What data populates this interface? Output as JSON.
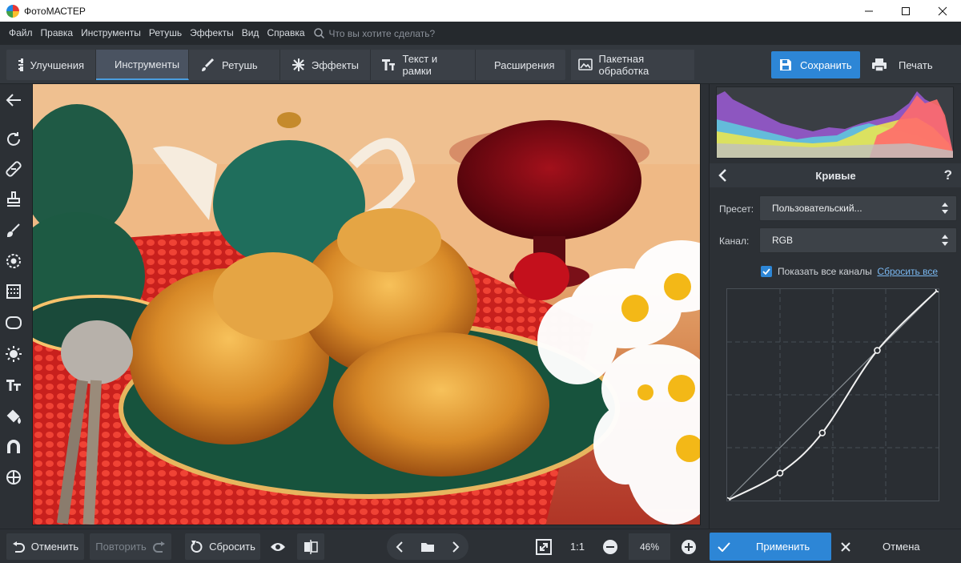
{
  "window": {
    "title": "ФотоМАСТЕР",
    "controls": [
      "minimize",
      "maximize",
      "close"
    ]
  },
  "menu": {
    "items": [
      "Файл",
      "Правка",
      "Инструменты",
      "Ретушь",
      "Эффекты",
      "Вид",
      "Справка"
    ],
    "search_placeholder": "Что вы хотите сделать?"
  },
  "toolbar": {
    "tabs": [
      {
        "label": "Улучшения",
        "icon": "sliders-icon",
        "active": false
      },
      {
        "label": "Инструменты",
        "icon": "crop-icon",
        "active": true
      },
      {
        "label": "Ретушь",
        "icon": "brush-icon",
        "active": false
      },
      {
        "label": "Эффекты",
        "icon": "sparkle-icon",
        "active": false
      },
      {
        "label": "Текст и рамки",
        "icon": "text-icon",
        "active": false
      },
      {
        "label": "Расширения",
        "icon": "plus-icon",
        "active": false
      }
    ],
    "batch_label": "Пакетная обработка",
    "save_label": "Сохранить",
    "print_label": "Печать"
  },
  "left_tools": [
    "back-arrow-icon",
    "rotate-icon",
    "healing-icon",
    "stamp-icon",
    "brush-icon",
    "radial-icon",
    "gradient-icon",
    "vignette-icon",
    "light-icon",
    "text-icon",
    "fill-icon",
    "magnet-icon",
    "target-icon"
  ],
  "panel": {
    "title": "Кривые",
    "help": "?",
    "preset_label": "Пресет:",
    "preset_value": "Пользовательский...",
    "channel_label": "Канал:",
    "channel_value": "RGB",
    "show_all_channels": "Показать все каналы",
    "show_all_checked": true,
    "reset_all": "Сбросить все",
    "curve_points": [
      [
        0,
        0
      ],
      [
        0.25,
        0.13
      ],
      [
        0.45,
        0.32
      ],
      [
        0.71,
        0.71
      ],
      [
        1,
        1
      ]
    ]
  },
  "bottom": {
    "undo": "Отменить",
    "redo": "Повторить",
    "reset": "Сбросить",
    "ratio": "1:1",
    "zoom": "46%",
    "apply": "Применить",
    "cancel": "Отмена"
  },
  "colors": {
    "accent": "#2d86d6",
    "bg": "#2c3035",
    "toolbar": "#33383e"
  }
}
